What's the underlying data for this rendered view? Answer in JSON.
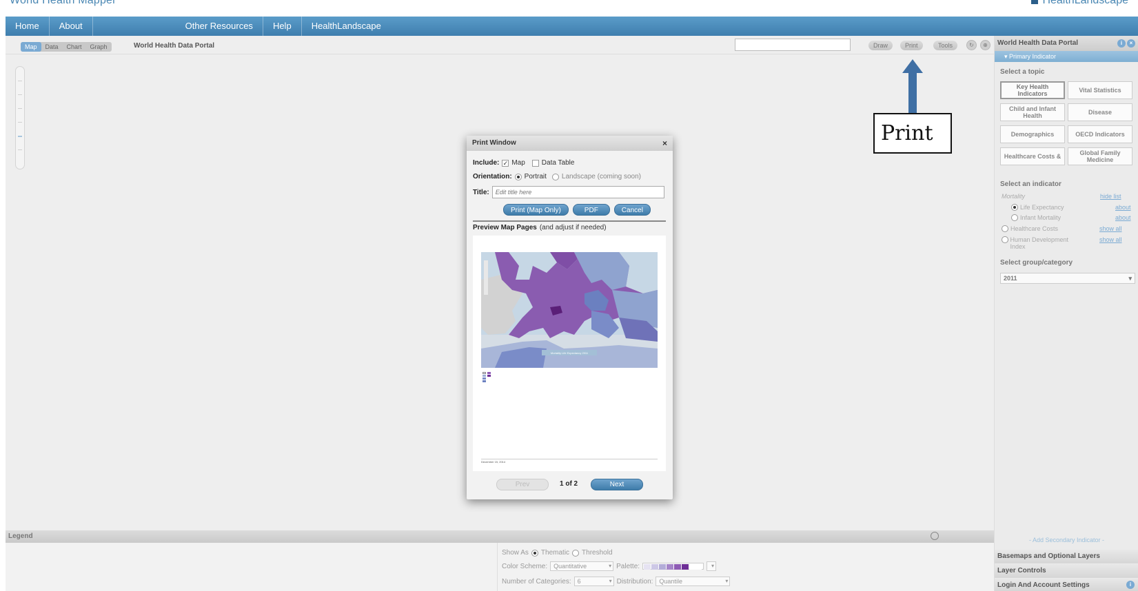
{
  "app": {
    "title": "World Health Mapper",
    "brand": "HealthLandscape"
  },
  "nav": {
    "items": [
      "Home",
      "About",
      "Other Resources",
      "Help",
      "HealthLandscape"
    ]
  },
  "toolbar": {
    "view_tabs": [
      "Map",
      "Data",
      "Chart",
      "Graph"
    ],
    "active_tab": "Map",
    "portal_title": "World Health Data Portal",
    "search_value": "",
    "draw_label": "Draw",
    "print_label": "Print",
    "tools_label": "Tools"
  },
  "annotation": {
    "label": "Print"
  },
  "print_dialog": {
    "title": "Print Window",
    "close_glyph": "×",
    "include_label": "Include:",
    "map_label": "Map",
    "map_checked": true,
    "data_table_label": "Data Table",
    "data_table_checked": false,
    "orientation_label": "Orientation:",
    "portrait_label": "Portrait",
    "landscape_label": "Landscape (coming soon)",
    "title_label": "Title:",
    "title_placeholder": "Edit title here",
    "print_button": "Print (Map Only)",
    "pdf_button": "PDF",
    "cancel_button": "Cancel",
    "preview_heading": "Preview Map Pages",
    "preview_hint": "(and adjust if needed)",
    "preview_map_caption": "Mortality Life Expectancy 2011",
    "preview_date": "December 15, 2014",
    "prev_label": "Prev",
    "page_indicator": "1 of 2",
    "next_label": "Next"
  },
  "legend": {
    "title": "Legend",
    "show_as_label": "Show As",
    "thematic_label": "Thematic",
    "threshold_label": "Threshold",
    "color_scheme_label": "Color Scheme:",
    "color_scheme_value": "Quantitative",
    "palette_label": "Palette:",
    "categories_label": "Number of Categories:",
    "categories_value": "6",
    "distribution_label": "Distribution:",
    "distribution_value": "Quantile",
    "palette_colors": [
      "#e6e3f2",
      "#cdc8e6",
      "#b3acd8",
      "#a585c9",
      "#8e5bb5",
      "#6e2e96"
    ]
  },
  "right_panel": {
    "title": "World Health Data Portal",
    "primary_indicator": "▾ Primary Indicator",
    "select_topic_label": "Select a topic",
    "topics": [
      {
        "label": "Key Health Indicators",
        "active": true
      },
      {
        "label": "Vital Statistics",
        "active": false
      },
      {
        "label": "Child and Infant Health",
        "active": false
      },
      {
        "label": "Disease",
        "active": false
      },
      {
        "label": "Demographics",
        "active": false
      },
      {
        "label": "OECD Indicators",
        "active": false
      },
      {
        "label": "Healthcare Costs &",
        "active": false
      },
      {
        "label": "Global Family Medicine",
        "active": false
      }
    ],
    "select_indicator_label": "Select an indicator",
    "mortality_label": "Mortality",
    "hide_list_link": "hide list",
    "life_expectancy_label": "Life Expectancy",
    "infant_mortality_label": "Infant Mortality",
    "healthcare_costs_label": "Healthcare Costs",
    "hdi_label": "Human Development Index",
    "about_link": "about",
    "show_all_link": "show all",
    "select_group_label": "Select group/category",
    "group_value": "2011",
    "add_secondary": "- Add Secondary Indicator -",
    "basemaps_label": "Basemaps and Optional Layers",
    "layer_controls_label": "Layer Controls",
    "login_label": "Login And Account Settings"
  },
  "colors": {
    "nav_blue": "#4a87b3",
    "accent_purple": "#8e5bb5",
    "annotation_arrow": "#3f6fa4"
  }
}
